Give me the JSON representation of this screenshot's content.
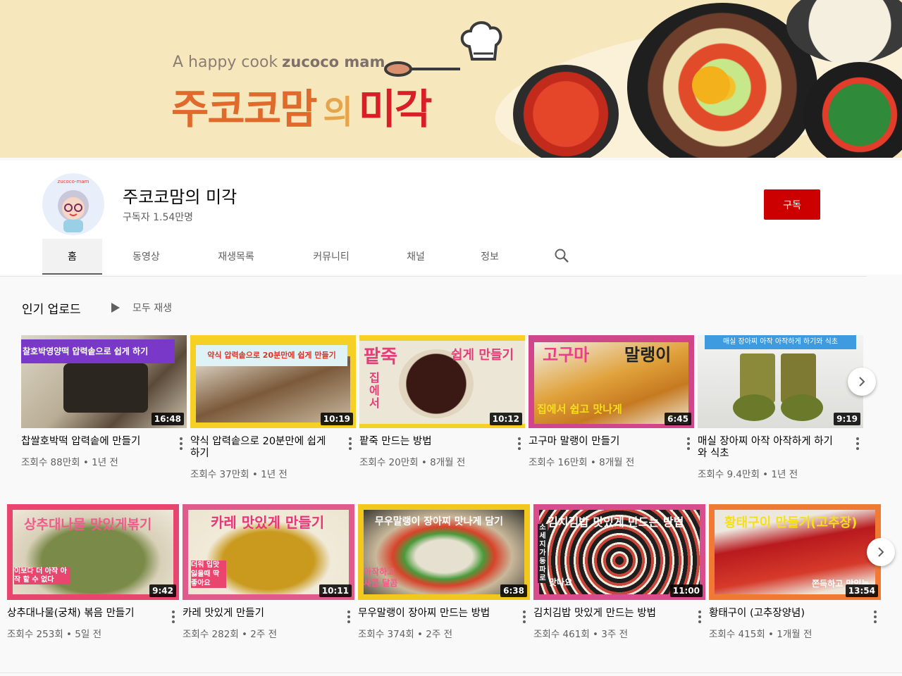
{
  "banner": {
    "tagline_prefix": "A happy cook",
    "tagline_brand": "zucoco mam",
    "title_part1": "주코코맘",
    "title_part2": "의",
    "title_part3": "미각"
  },
  "channel": {
    "avatar_text": "zucoco-mam",
    "name": "주코코맘의 미각",
    "subscribers": "구독자 1.54만명",
    "subscribe_label": "구독"
  },
  "tabs": [
    {
      "label": "홈",
      "active": true
    },
    {
      "label": "동영상"
    },
    {
      "label": "재생목록"
    },
    {
      "label": "커뮤니티"
    },
    {
      "label": "채널"
    },
    {
      "label": "정보"
    }
  ],
  "shelf": {
    "title": "인기 업로드",
    "play_all": "모두 재생"
  },
  "row1": [
    {
      "title": "찹쌀호박떡 압력솥에 만들기",
      "meta": "조회수 88만회 • 1년 전",
      "duration": "16:48",
      "caption": "찰호박영양떡 압력솥으로 쉽게 하기"
    },
    {
      "title": "약식 압력솥으로 20분만에 쉽게하기",
      "meta": "조회수 37만회 • 1년 전",
      "duration": "10:19",
      "caption": "약식 압력솥으로 20분만에 쉽게 만들기"
    },
    {
      "title": "팥죽 만드는 방법",
      "meta": "조회수 20만회 • 8개월 전",
      "duration": "10:12",
      "caption": "팥죽",
      "caption2": "쉽게 만들기",
      "caption3": "집에서"
    },
    {
      "title": "고구마 말랭이 만들기",
      "meta": "조회수 16만회 • 8개월 전",
      "duration": "6:45",
      "caption": "고구마",
      "caption2": "말랭이",
      "caption3": "집에서 쉽고 맛나게"
    },
    {
      "title": "매실 장아찌 아작 아작하게 하기와 식초",
      "meta": "조회수 9.4만회 • 1년 전",
      "duration": "9:19",
      "caption": "매실 장아찌  아작 아작하게 하기와 식초"
    }
  ],
  "row2": [
    {
      "title": "상추대나물(궁채) 볶음 만들기",
      "meta": "조회수 253회 • 5일 전",
      "duration": "9:42",
      "caption": "상추대나물 맛있게볶기",
      "caption2": "이보다 더 아작 아작 할 수 없다"
    },
    {
      "title": "카레 맛있게 만들기",
      "meta": "조회수 282회 • 2주 전",
      "duration": "10:11",
      "caption": "카레 맛있게 만들기",
      "caption2": "더워 입맛 잃을때 딱 좋아요"
    },
    {
      "title": "무우말랭이 장아찌 만드는 방법",
      "meta": "조회수 374회 • 2주 전",
      "duration": "6:38",
      "caption": "무우말랭이 장아찌 맛나게 담기",
      "caption2": "아작하고 새콤 달콤"
    },
    {
      "title": "김치김밥 맛있게 만드는 방법",
      "meta": "조회수 461회 • 3주 전",
      "duration": "11:00",
      "caption": "김치김밥 맛있게 만드는 방법",
      "caption2": "소세지 가 동 파 로",
      "caption3": "맛나요"
    },
    {
      "title": "황태구이 (고추장양념)",
      "meta": "조회수 415회 • 1개월 전",
      "duration": "13:54",
      "caption": "황태구이 만들기(고추장)",
      "caption2": "쫀득하고 맛있는"
    }
  ],
  "colors": {
    "subscribe": "#cc0000",
    "banner_bg": "#f6e7bd",
    "title_orange": "#e06a2c",
    "title_red": "#d61f26"
  }
}
